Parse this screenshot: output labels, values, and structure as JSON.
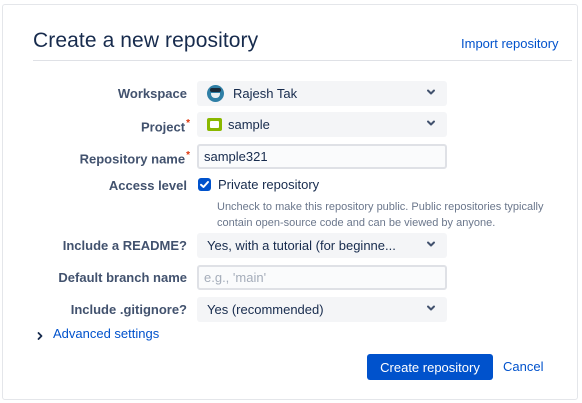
{
  "header": {
    "title": "Create a new repository",
    "import_link": "Import repository"
  },
  "fields": {
    "workspace": {
      "label": "Workspace",
      "value": "Rajesh Tak",
      "icon": "user-avatar-icon"
    },
    "project": {
      "label": "Project",
      "required_mark": "*",
      "value": "sample",
      "icon": "project-icon"
    },
    "repository_name": {
      "label": "Repository name",
      "required_mark": "*",
      "value": "sample321"
    },
    "access_level": {
      "label": "Access level",
      "checkbox_label": "Private repository",
      "checked": true,
      "helper": "Uncheck to make this repository public. Public repositories typically contain open-source code and can be viewed by anyone."
    },
    "readme": {
      "label": "Include a README?",
      "value": "Yes, with a tutorial (for beginne..."
    },
    "default_branch": {
      "label": "Default branch name",
      "value": "",
      "placeholder": "e.g., 'main'"
    },
    "gitignore": {
      "label": "Include .gitignore?",
      "value": "Yes (recommended)"
    }
  },
  "advanced": {
    "label": "Advanced settings"
  },
  "actions": {
    "create_label": "Create repository",
    "cancel_label": "Cancel"
  },
  "colors": {
    "primary": "#0052cc",
    "required": "#de350b",
    "text": "#172b4d",
    "label": "#42526e",
    "field_bg": "#f4f5f7"
  }
}
